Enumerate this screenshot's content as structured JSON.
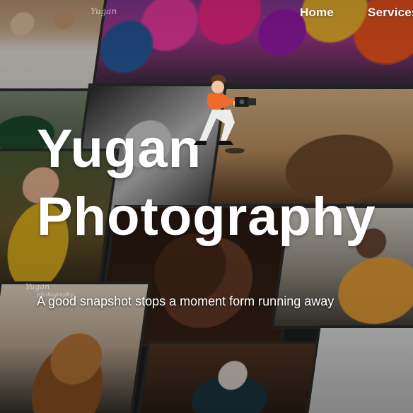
{
  "brand": {
    "logo_text": "Yugan"
  },
  "nav": {
    "items": [
      {
        "label": "Home"
      },
      {
        "label": "Services"
      }
    ]
  },
  "hero": {
    "title_line1": "Yugan",
    "title_line2": "Photography",
    "tagline": "A good snapshot stops a moment form running away",
    "watermark_main": "Yugan",
    "watermark_sub": "photography"
  },
  "icons": {
    "photographer": "photographer-illustration",
    "camera": "camera-icon"
  }
}
